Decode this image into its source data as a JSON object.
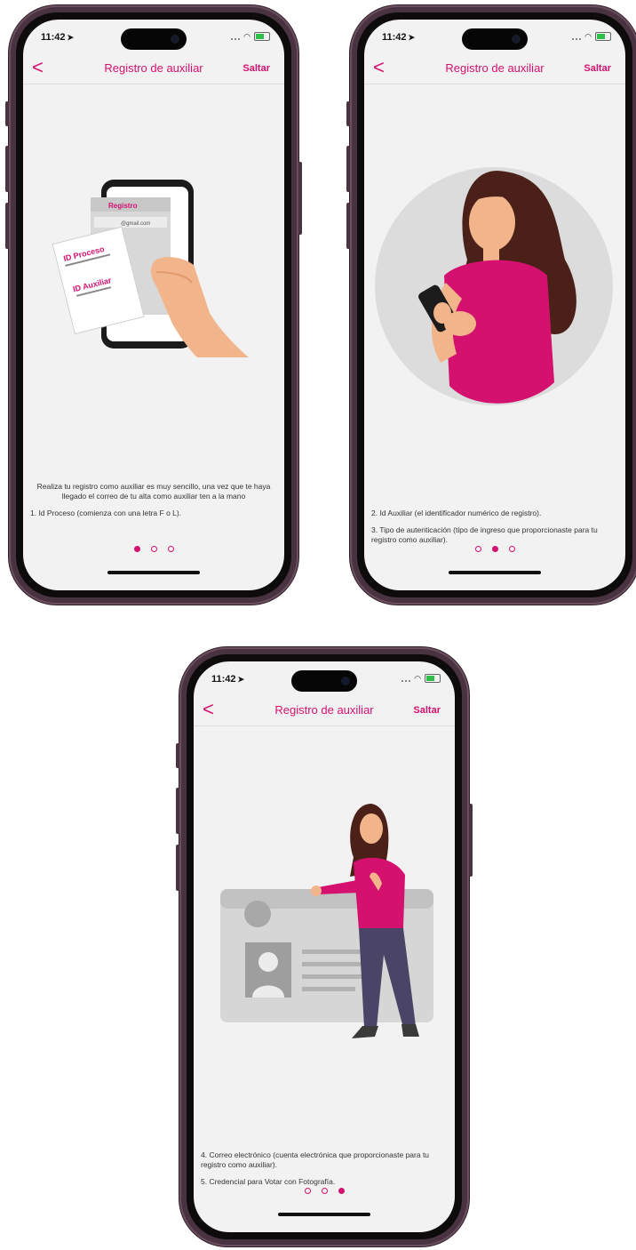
{
  "status": {
    "time": "11:42",
    "location_glyph": "➤"
  },
  "nav": {
    "back_glyph": "<",
    "title": "Registro de auxiliar",
    "skip": "Saltar"
  },
  "colors": {
    "accent": "#d4116f",
    "screen_bg": "#f2f2f2",
    "frame": "#4a3340"
  },
  "screens": [
    {
      "illustration": {
        "card_header": "Registro",
        "card_email": "@gmail.com",
        "id_proceso": "ID Proceso",
        "id_auxiliar": "ID Auxiliar"
      },
      "caption": [
        "Realiza tu registro como auxiliar es muy sencillo, una vez que te haya llegado el correo de tu alta como auxiliar ten a la mano",
        "1. Id Proceso (comienza con una letra F o L)."
      ],
      "active_dot": 0
    },
    {
      "caption": [
        "2. Id Auxiliar (el identificador numérico de registro).",
        "3. Tipo de autenticación (tipo de ingreso que proporcionaste para tu registro como auxiliar)."
      ],
      "active_dot": 1
    },
    {
      "caption": [
        "4. Correo electrónico (cuenta electrónica que proporcionaste para tu registro como auxiliar).",
        "5. Credencial para Votar con Fotografía."
      ],
      "active_dot": 2
    }
  ]
}
